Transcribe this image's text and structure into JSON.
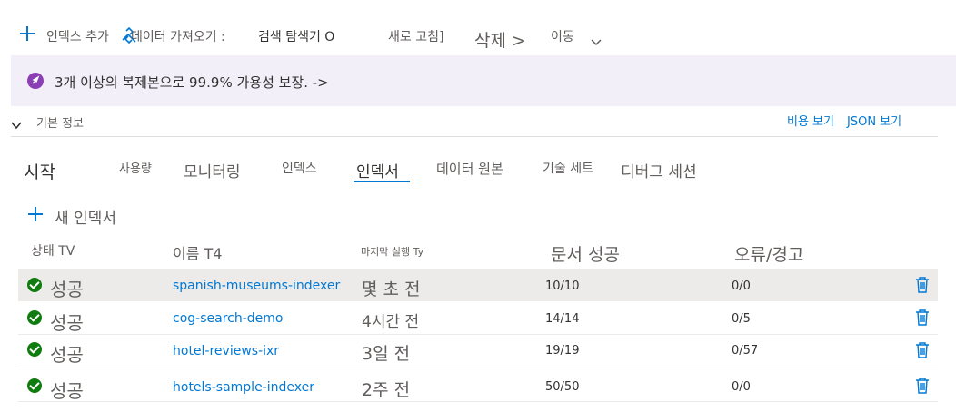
{
  "toolbar": {
    "add_index": "인덱스 추가",
    "import_data": "데이터 가져오기 :",
    "search_explorer": "검색 탐색기 O",
    "refresh": "새로 고침]",
    "delete": "삭제 >",
    "move": "이동"
  },
  "banner": {
    "text": "3개 이상의 복제본으로 99.9% 가용성 보장. ->"
  },
  "essentials": {
    "label": "기본 정보",
    "view_cost": "비용 보기",
    "view_json": "JSON 보기"
  },
  "tabs": [
    {
      "label": "시작"
    },
    {
      "label": "사용량"
    },
    {
      "label": "모니터링"
    },
    {
      "label": "인덱스"
    },
    {
      "label": "인덱서"
    },
    {
      "label": "데이터 원본"
    },
    {
      "label": "기술 세트"
    },
    {
      "label": "디버그 세션"
    }
  ],
  "new_indexer": "새 인덱서",
  "table": {
    "headers": {
      "status": "상태 TV",
      "name": "이름 T4",
      "last_run": "마지막 실행 Ty",
      "docs_succeeded": "문서 성공",
      "errors_warnings": "오류/경고"
    },
    "rows": [
      {
        "status": "성공",
        "name": "spanish-museums-indexer",
        "last_run": "몇 초 전",
        "docs": "10/10",
        "errors": "0/0"
      },
      {
        "status": "성공",
        "name": "cog-search-demo",
        "last_run": "4시간 전",
        "docs": "14/14",
        "errors": "0/5"
      },
      {
        "status": "성공",
        "name": "hotel-reviews-ixr",
        "last_run": "3일 전",
        "docs": "19/19",
        "errors": "0/57"
      },
      {
        "status": "성공",
        "name": "hotels-sample-indexer",
        "last_run": "2주 전",
        "docs": "50/50",
        "errors": "0/0"
      }
    ]
  },
  "colors": {
    "accent": "#0078d4",
    "success": "#107c10",
    "banner_bg": "#f3eff9",
    "banner_icon": "#8a3fb5"
  },
  "icons": {
    "add": "plus-icon",
    "import": "link-icon",
    "move": "chevron-down-icon",
    "banner": "rocket-icon",
    "status": "check-circle-icon",
    "delete_row": "trash-icon"
  }
}
